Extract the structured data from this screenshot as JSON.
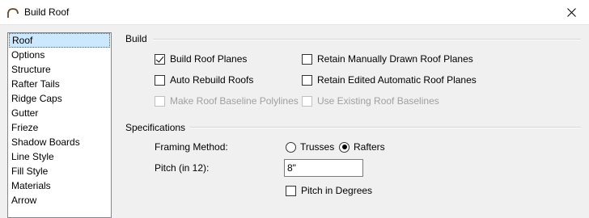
{
  "window": {
    "title": "Build Roof",
    "icon": "roof-arch-icon",
    "close_icon": "close-icon"
  },
  "sidebar": {
    "items": [
      {
        "label": "Roof",
        "selected": true
      },
      {
        "label": "Options"
      },
      {
        "label": "Structure"
      },
      {
        "label": "Rafter Tails"
      },
      {
        "label": "Ridge Caps"
      },
      {
        "label": "Gutter"
      },
      {
        "label": "Frieze"
      },
      {
        "label": "Shadow Boards"
      },
      {
        "label": "Line Style"
      },
      {
        "label": "Fill Style"
      },
      {
        "label": "Materials"
      },
      {
        "label": "Arrow"
      }
    ]
  },
  "build": {
    "title": "Build",
    "build_roof_planes": {
      "label": "Build Roof Planes",
      "checked": true
    },
    "retain_manual": {
      "label": "Retain Manually Drawn Roof Planes",
      "checked": false
    },
    "auto_rebuild": {
      "label": "Auto Rebuild Roofs",
      "checked": false
    },
    "retain_edited": {
      "label": "Retain Edited Automatic Roof Planes",
      "checked": false
    },
    "make_baseline": {
      "label": "Make Roof Baseline Polylines",
      "checked": false,
      "disabled": true
    },
    "use_existing": {
      "label": "Use Existing Roof Baselines",
      "checked": false,
      "disabled": true
    }
  },
  "specifications": {
    "title": "Specifications",
    "framing_label": "Framing Method:",
    "trusses_label": "Trusses",
    "rafters_label": "Rafters",
    "framing_selected": "Rafters",
    "pitch_label": "Pitch (in 12):",
    "pitch_value": "8\"",
    "pitch_degrees": {
      "label": "Pitch in Degrees",
      "checked": false
    }
  },
  "colors": {
    "selection_bg": "#cce8ff",
    "selection_border": "#0078d7",
    "disabled_text": "#a0a0a0"
  }
}
